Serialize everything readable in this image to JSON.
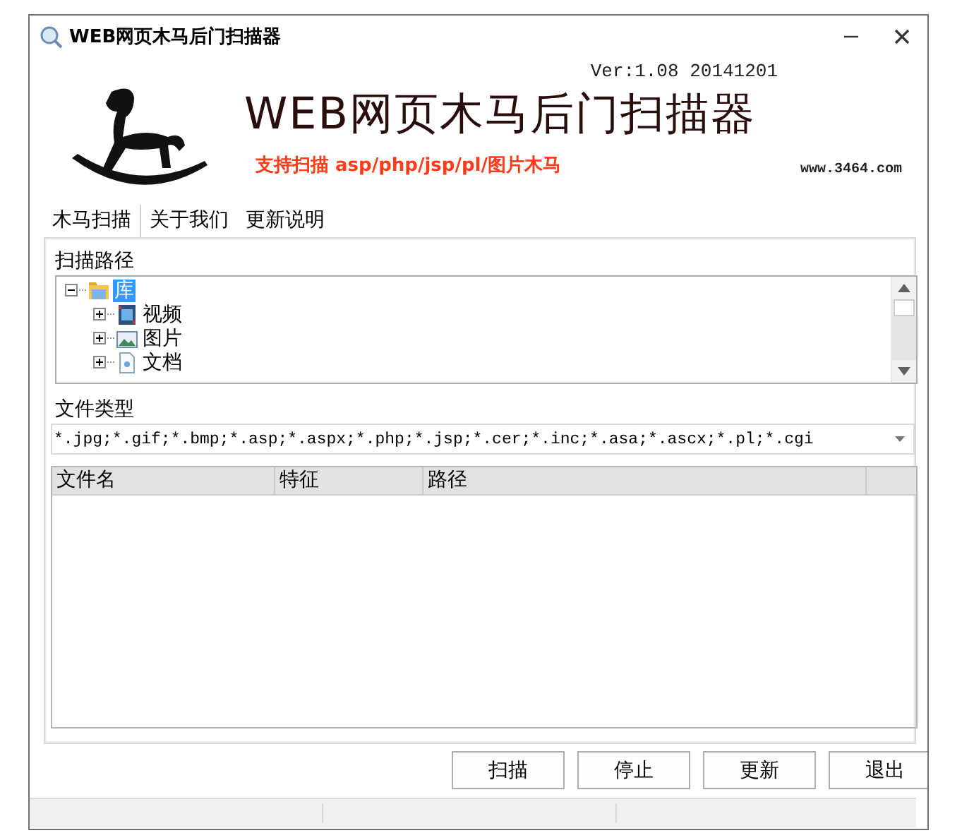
{
  "window": {
    "title": "WEB网页木马后门扫描器"
  },
  "header": {
    "version": "Ver:1.08 20141201",
    "title": "WEB网页木马后门扫描器",
    "subtitle": "支持扫描 asp/php/jsp/pl/图片木马",
    "website": "www.3464.com"
  },
  "tabs": [
    {
      "label": "木马扫描",
      "selected": true
    },
    {
      "label": "关于我们",
      "selected": false
    },
    {
      "label": "更新说明",
      "selected": false
    }
  ],
  "scan_path": {
    "label": "扫描路径",
    "tree": [
      {
        "label": "库",
        "kind": "library",
        "expanded": true,
        "selected": true,
        "children": [
          {
            "label": "视频",
            "kind": "video",
            "expanded": false,
            "selected": false
          },
          {
            "label": "图片",
            "kind": "pictures",
            "expanded": false,
            "selected": false
          },
          {
            "label": "文档",
            "kind": "documents",
            "expanded": false,
            "selected": false
          }
        ]
      }
    ]
  },
  "file_type": {
    "label": "文件类型",
    "value": "*.jpg;*.gif;*.bmp;*.asp;*.aspx;*.php;*.jsp;*.cer;*.inc;*.asa;*.ascx;*.pl;*.cgi"
  },
  "results": {
    "columns": [
      "文件名",
      "特征",
      "路径"
    ]
  },
  "buttons": [
    "扫描",
    "停止",
    "更新",
    "退出"
  ]
}
